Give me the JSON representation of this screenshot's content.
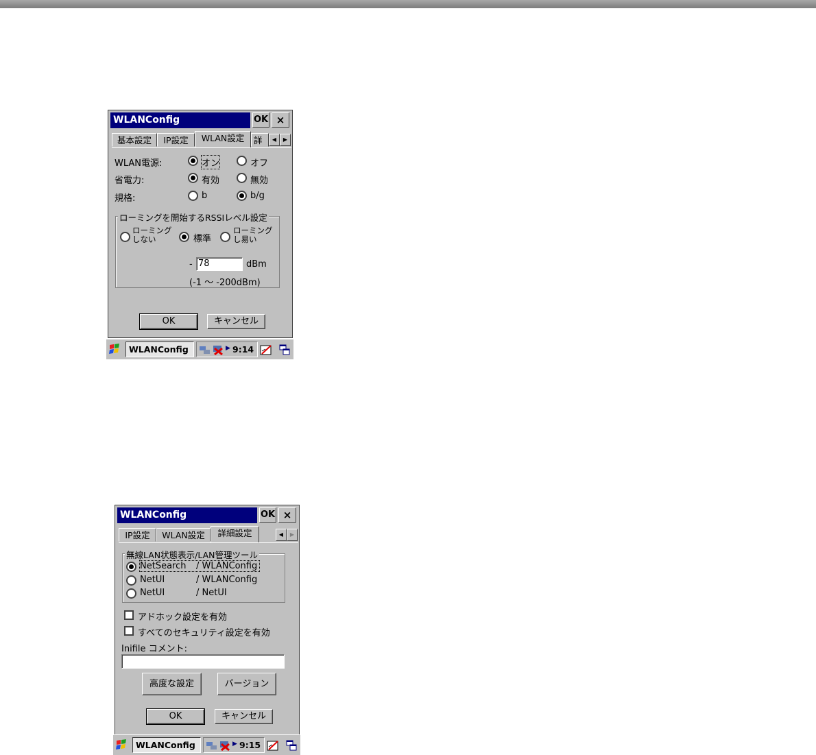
{
  "screenshots": [
    {
      "window_title": "WLANConfig",
      "ok_label": "OK",
      "close_label": "×",
      "tabs": [
        "基本設定",
        "IP設定",
        "WLAN設定",
        "詳細"
      ],
      "active_tab": "WLAN設定",
      "rows": [
        {
          "label": "WLAN電源:",
          "opt1": "オン",
          "opt2": "オフ",
          "selected": "オン"
        },
        {
          "label": "省電力:",
          "opt1": "有効",
          "opt2": "無効",
          "selected": "有効"
        },
        {
          "label": "規格:",
          "opt1": "b",
          "opt2": "b/g",
          "selected": "b/g"
        }
      ],
      "roaming_group": {
        "title": "ローミングを開始するRSSIレベル設定",
        "options": [
          {
            "line1": "ローミング",
            "line2": "しない",
            "selected": false
          },
          {
            "line1": "標準",
            "line2": "",
            "selected": true
          },
          {
            "line1": "ローミング",
            "line2": "し易い",
            "selected": false
          }
        ],
        "minus": "-",
        "value": "78",
        "unit": "dBm",
        "range": "(-1 ～ -200dBm)"
      },
      "ok_button": "OK",
      "cancel_button": "キャンセル",
      "taskbar": {
        "task": "WLANConfig",
        "time": "9:14"
      }
    },
    {
      "window_title": "WLANConfig",
      "ok_label": "OK",
      "close_label": "×",
      "tabs": [
        "IP設定",
        "WLAN設定",
        "詳細設定"
      ],
      "active_tab": "詳細設定",
      "tool_group": {
        "title": "無線LAN状態表示/LAN管理ツール",
        "options": [
          {
            "a": "NetSearch",
            "b": "/ WLANConfig",
            "selected": true
          },
          {
            "a": "NetUI",
            "b": "/ WLANConfig",
            "selected": false
          },
          {
            "a": "NetUI",
            "b": "/ NetUI",
            "selected": false
          }
        ]
      },
      "checkboxes": [
        {
          "label": "アドホック設定を有効",
          "checked": false
        },
        {
          "label": "すべてのセキュリティ設定を有効",
          "checked": false
        }
      ],
      "inifile_label": "Inifile コメント:",
      "inifile_value": "",
      "advanced_button": "高度な設定",
      "version_button": "バージョン",
      "ok_button": "OK",
      "cancel_button": "キャンセル",
      "taskbar": {
        "task": "WLANConfig",
        "time": "9:15"
      }
    }
  ]
}
